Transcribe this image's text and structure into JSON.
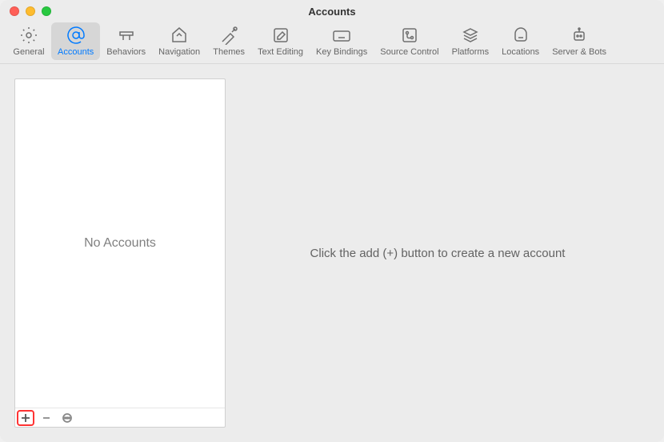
{
  "window": {
    "title": "Accounts"
  },
  "toolbar": {
    "items": [
      {
        "id": "general",
        "label": "General",
        "active": false
      },
      {
        "id": "accounts",
        "label": "Accounts",
        "active": true
      },
      {
        "id": "behaviors",
        "label": "Behaviors",
        "active": false
      },
      {
        "id": "navigation",
        "label": "Navigation",
        "active": false
      },
      {
        "id": "themes",
        "label": "Themes",
        "active": false
      },
      {
        "id": "text-editing",
        "label": "Text Editing",
        "active": false
      },
      {
        "id": "key-bindings",
        "label": "Key Bindings",
        "active": false
      },
      {
        "id": "source-control",
        "label": "Source Control",
        "active": false
      },
      {
        "id": "platforms",
        "label": "Platforms",
        "active": false
      },
      {
        "id": "locations",
        "label": "Locations",
        "active": false
      },
      {
        "id": "server-bots",
        "label": "Server & Bots",
        "active": false
      }
    ]
  },
  "sidebar": {
    "empty_message": "No Accounts"
  },
  "main": {
    "message": "Click the add (+) button to create a new account"
  }
}
